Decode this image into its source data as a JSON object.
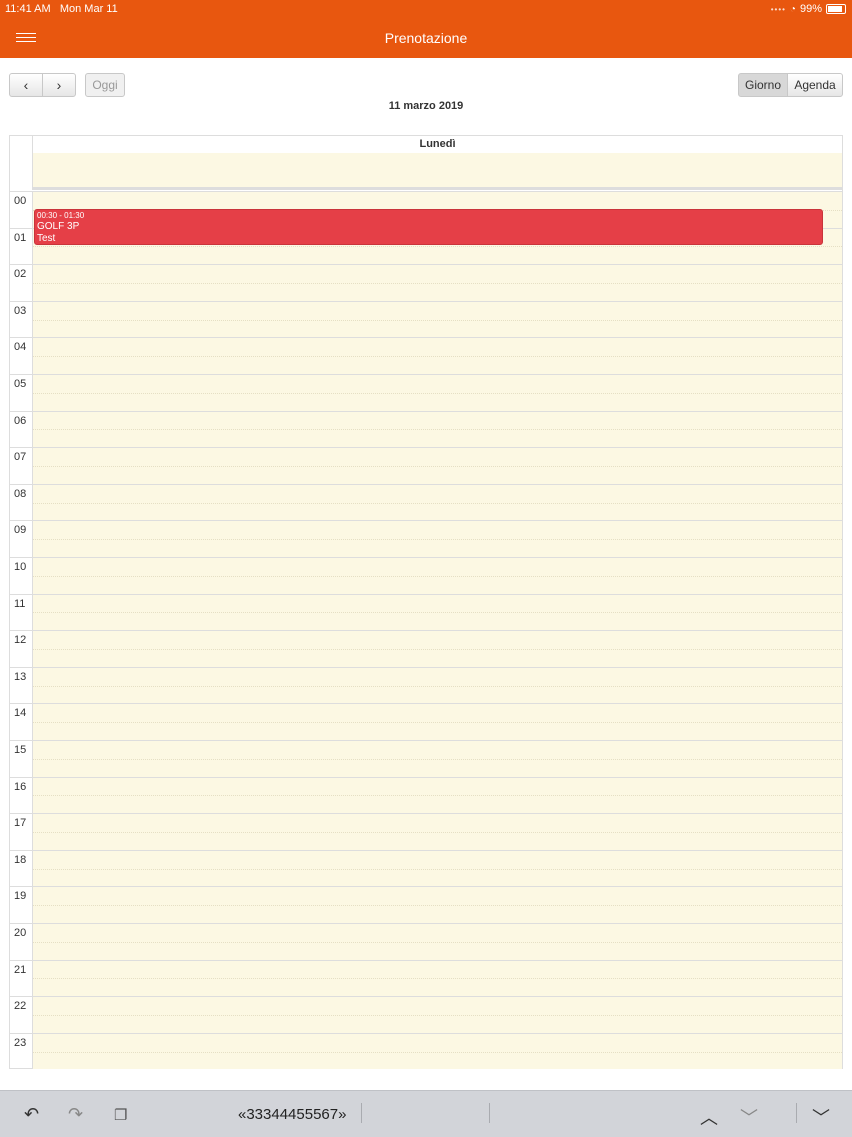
{
  "statusbar": {
    "time": "11:41 AM",
    "date": "Mon Mar 11",
    "battery": "99%"
  },
  "navbar": {
    "title": "Prenotazione"
  },
  "toolbar": {
    "prev": "‹",
    "next": "›",
    "today": "Oggi",
    "day": "Giorno",
    "agenda": "Agenda"
  },
  "calendar": {
    "date_title": "11 marzo 2019",
    "day_header": "Lunedì",
    "hours": [
      "00",
      "01",
      "02",
      "03",
      "04",
      "05",
      "06",
      "07",
      "08",
      "09",
      "10",
      "11",
      "12",
      "13",
      "14",
      "15",
      "16",
      "17",
      "18",
      "19",
      "20",
      "21",
      "22",
      "23"
    ],
    "event": {
      "time": "00:30 - 01:30",
      "name": "GOLF 3P",
      "note": "Test",
      "color": "#e53f47"
    }
  },
  "keyboard_bar": {
    "suggestion": "«33344455567»"
  },
  "colors": {
    "accent": "#e8570f",
    "cell_bg": "#fcf8e3"
  }
}
